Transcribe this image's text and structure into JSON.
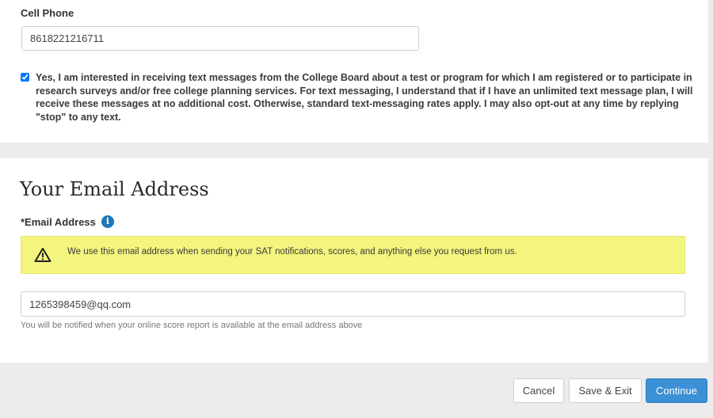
{
  "phone_section": {
    "label": "Cell Phone",
    "value": "8618221216711",
    "consent_checked": true,
    "consent_text": "Yes, I am interested in receiving text messages from the College Board about a test or program for which I am registered or to participate in research surveys and/or free college planning services. For text messaging, I understand that if I have an unlimited text message plan, I will receive these messages at no additional cost. Otherwise, standard text-messaging rates apply. I may also opt-out at any time by replying \"stop\" to any text."
  },
  "email_section": {
    "title": "Your Email Address",
    "label": "*Email Address",
    "info_icon_glyph": "i",
    "alert_text": "We use this email address when sending your SAT notifications, scores, and anything else you request from us.",
    "value": "1265398459@qq.com",
    "help_text": "You will be notified when your online score report is available at the email address above"
  },
  "actions": {
    "cancel_label": "Cancel",
    "save_exit_label": "Save & Exit",
    "continue_label": "Continue"
  },
  "colors": {
    "alert_background": "#f4f57e",
    "primary_button": "#3b90d6",
    "info_icon": "#1d78b8",
    "page_background": "#ececec"
  },
  "icons": {
    "warning": "warning-triangle-icon",
    "info": "info-circle-icon"
  }
}
